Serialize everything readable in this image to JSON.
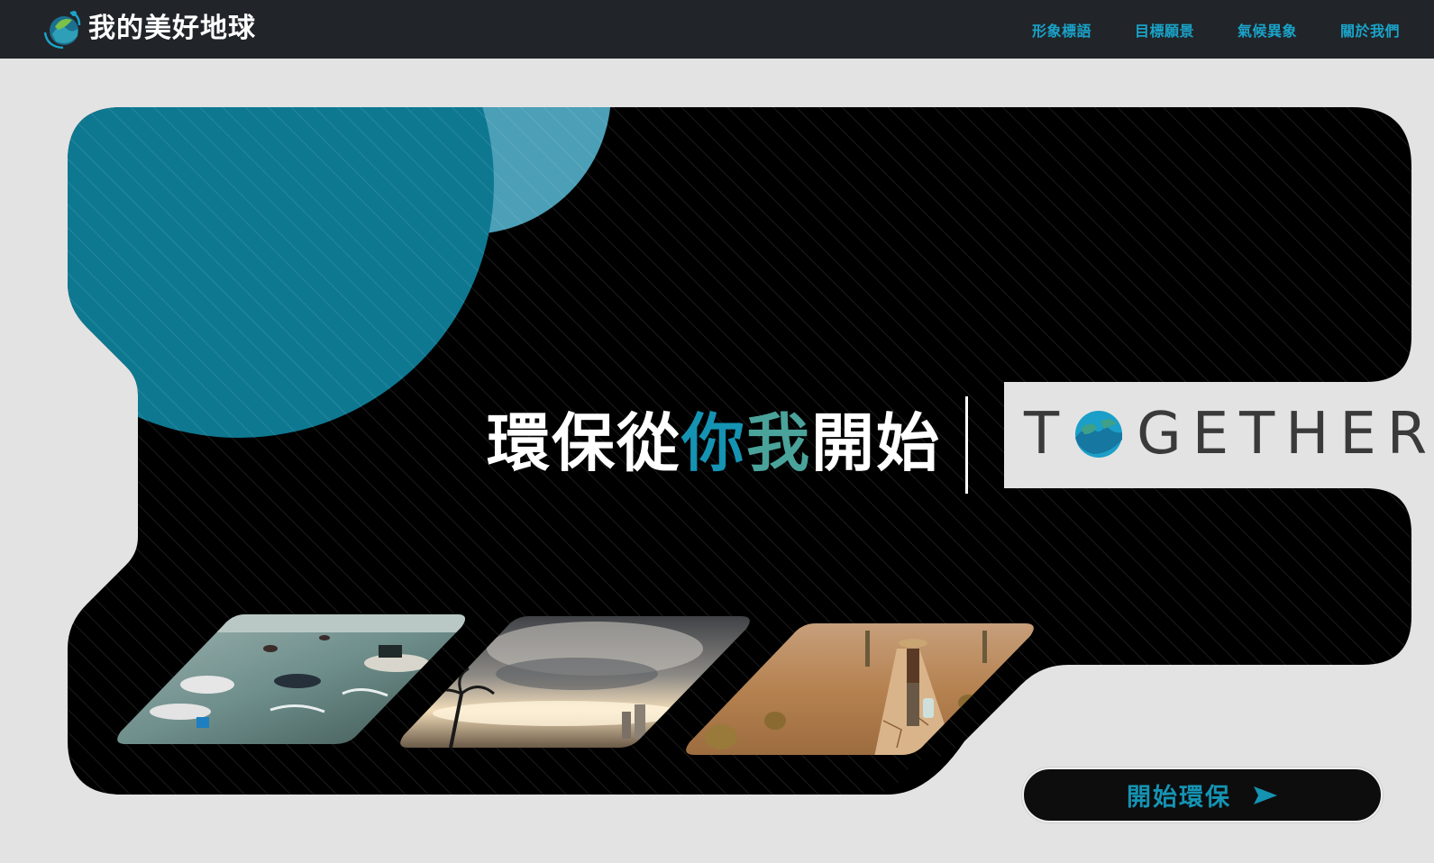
{
  "navbar": {
    "brand_title": "我的美好地球",
    "brand_logo_icon": "earth-leaf-logo-icon",
    "links": [
      {
        "label": "形象標語"
      },
      {
        "label": "目標願景"
      },
      {
        "label": "氣候異象"
      },
      {
        "label": "關於我們"
      }
    ]
  },
  "hero": {
    "slogan_part1": "環保從",
    "slogan_part2": "你",
    "slogan_part3": "我",
    "slogan_part4": "開始",
    "together_left": "T",
    "together_right": "GETHER",
    "together_logo_icon": "earth-globe-icon",
    "images": [
      {
        "name": "flood-image"
      },
      {
        "name": "storm-image"
      },
      {
        "name": "drought-image"
      }
    ]
  },
  "cta": {
    "label": "開始環保",
    "icon": "arrow-right-icon"
  },
  "colors": {
    "nav_bg": "#212529",
    "accent_blue": "#1593b3",
    "accent_teal": "#4aa39a",
    "hero_bg": "#000000",
    "page_bg": "#e3e3e3"
  }
}
